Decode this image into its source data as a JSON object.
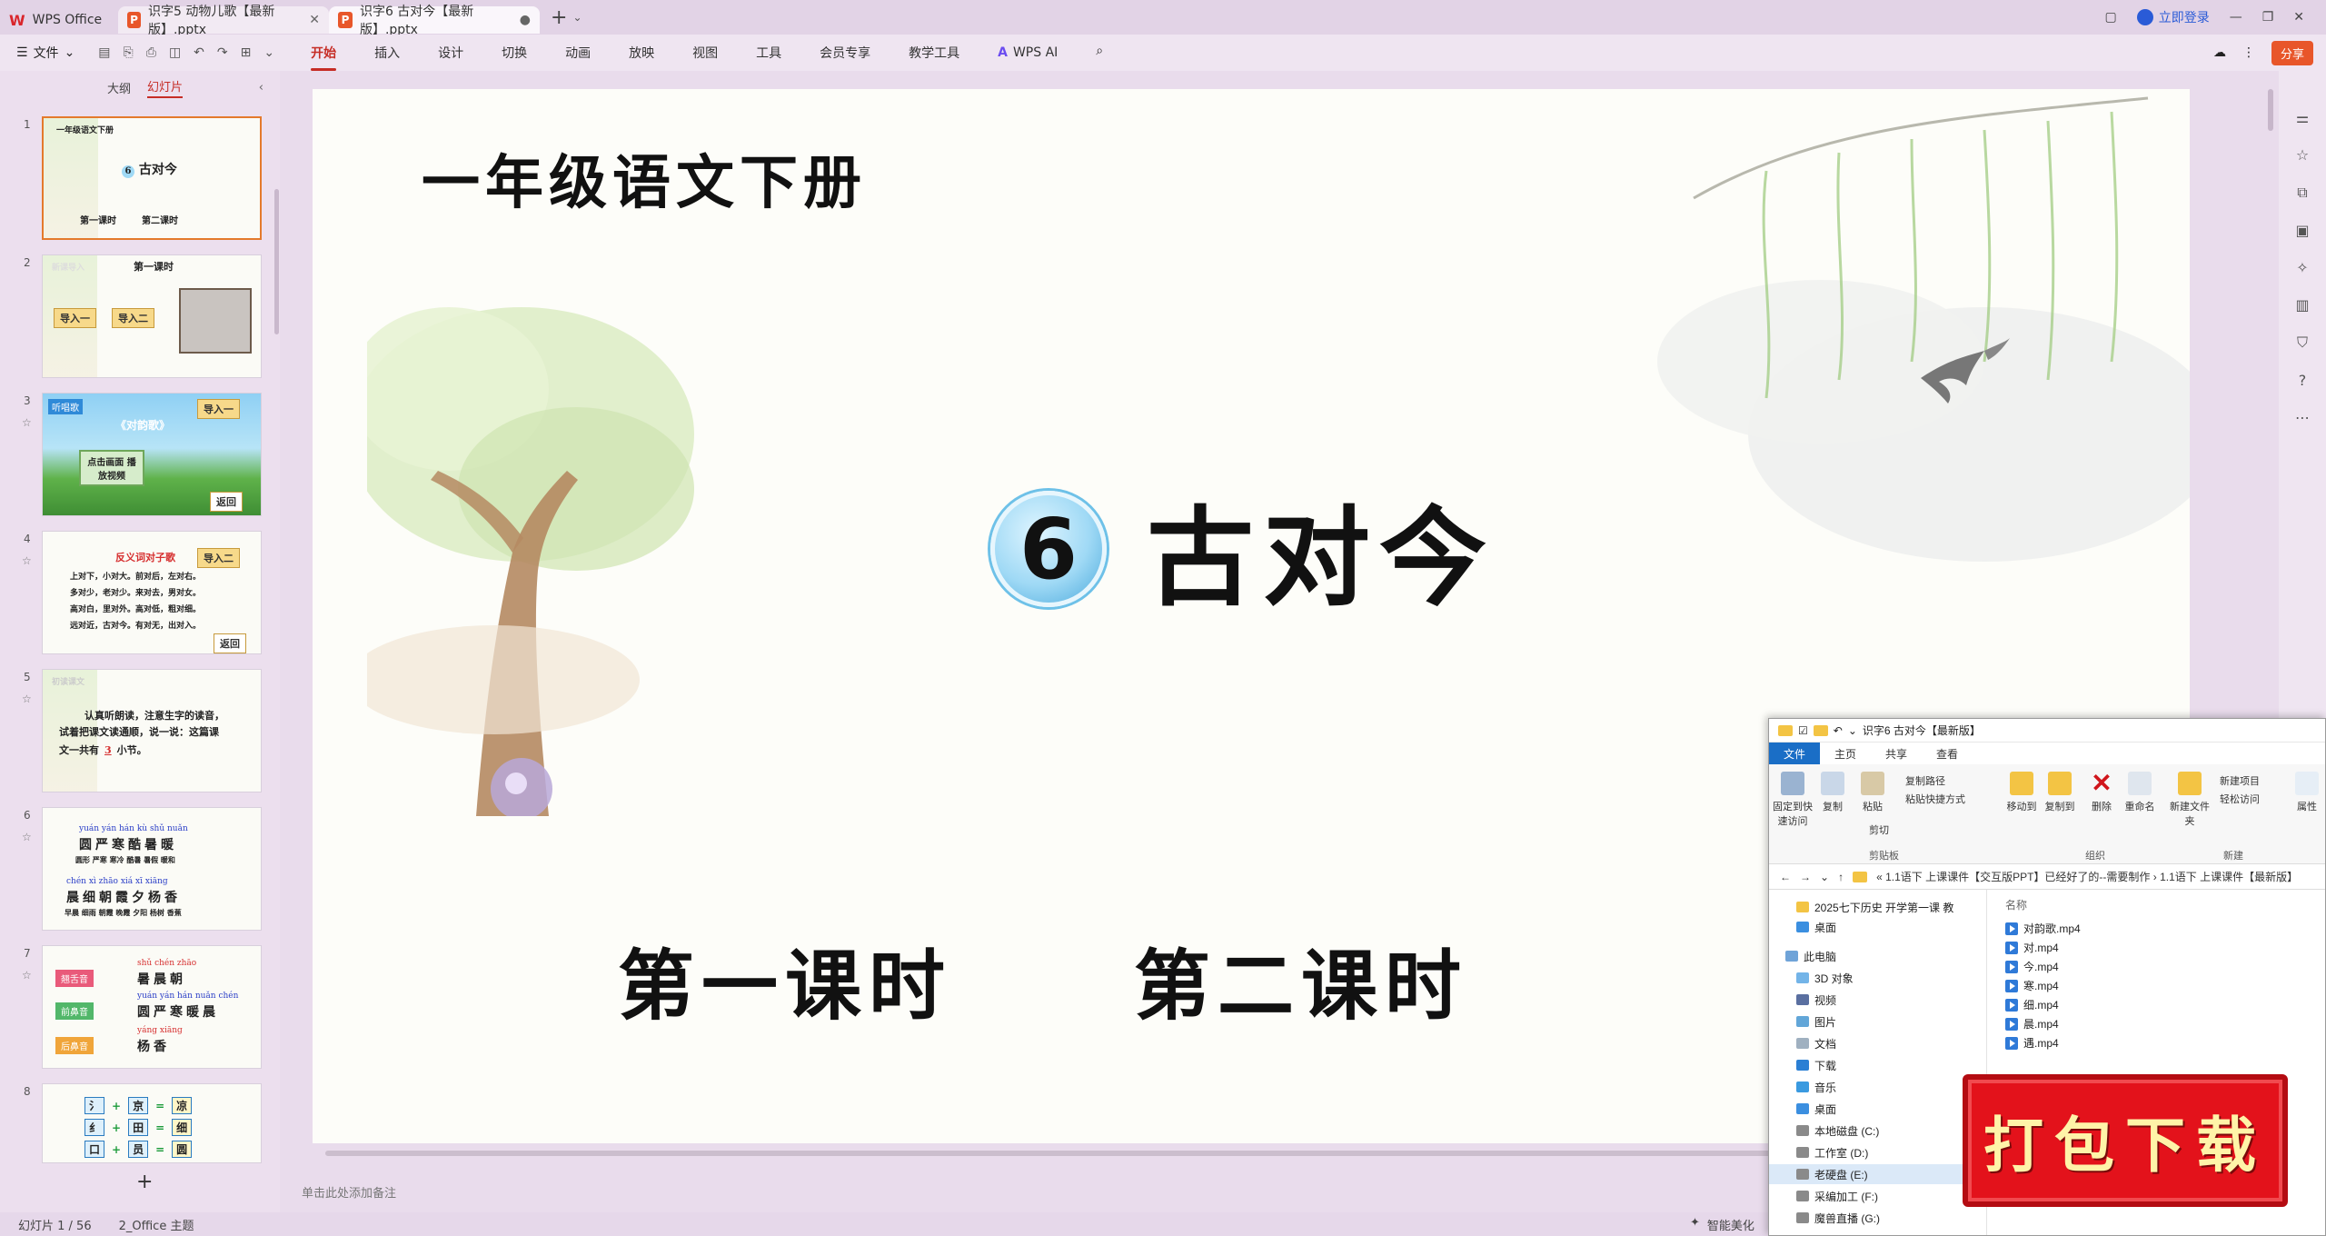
{
  "tabs": {
    "home": "WPS Office",
    "doc1": "识字5 动物儿歌【最新版】.pptx",
    "doc2": "识字6 古对今【最新版】.pptx"
  },
  "titlebar": {
    "login": "立即登录"
  },
  "menu": {
    "file": "文件",
    "items": [
      "开始",
      "插入",
      "设计",
      "切换",
      "动画",
      "放映",
      "视图",
      "工具",
      "会员专享",
      "教学工具"
    ],
    "wps_ai": "WPS AI",
    "share": "分享"
  },
  "panel": {
    "outline_tab": "大纲",
    "slides_tab": "幻灯片"
  },
  "thumbs": {
    "s1": {
      "num": "1",
      "top": "一年级语文下册",
      "title": "古对今",
      "p1": "第一课时",
      "p2": "第二课时"
    },
    "s2": {
      "num": "2",
      "heading": "第一课时",
      "corner": "新课导入",
      "b1": "导入一",
      "b2": "导入二"
    },
    "s3": {
      "num": "3",
      "badge": "听唱歌",
      "btn": "导入一",
      "song": "《对韵歌》",
      "box": "点击画面 播放视频",
      "back": "返回"
    },
    "s4": {
      "num": "4",
      "title": "反义词对子歌",
      "btn": "导入二",
      "lines": [
        "上对下，小对大。前对后，左对右。",
        "多对少，老对少。来对去，男对女。",
        "高对白，里对外。高对低，粗对细。",
        "远对近，古对今。有对无，出对入。"
      ],
      "back": "返回"
    },
    "s5": {
      "num": "5",
      "corner": "初读课文",
      "text1": "认真听朗读，注意生字的读音，",
      "text2": "试着把课文读通顺，说一说：这篇课",
      "text3": "文一共有",
      "blank": "3",
      "text4": "小节。"
    },
    "s6": {
      "num": "6",
      "row1_py": "yuán  yán  hán  kù  shǔ  nuǎn",
      "row1_hz": "圆严寒酷暑暖",
      "row1_words": "圆形 严寒 寒冷 酷暑 暑假 暖和",
      "row2_py": "chén  xì  zhāo  xiá  xī  xiāng",
      "row2_hz": "晨细朝霞夕杨香",
      "row2_words": "早晨 细雨 朝霞 晚霞 夕阳 杨树 香蕉"
    },
    "s7": {
      "num": "7",
      "tag1": "翘舌音",
      "tag2": "前鼻音",
      "tag3": "后鼻音",
      "py1": "shǔ  chén  zhāo",
      "hz1": "暑晨朝",
      "py2": "yuán  yán  hán  nuǎn  chén",
      "hz2": "圆严寒暖晨",
      "py3": "yáng  xiāng",
      "hz3": "杨香"
    },
    "s8": {
      "num": "8",
      "r1": [
        "氵",
        "+",
        "京",
        "=",
        "凉"
      ],
      "r2": [
        "纟",
        "+",
        "田",
        "=",
        "细"
      ],
      "r3": [
        "口",
        "+",
        "员",
        "=",
        "圆"
      ]
    }
  },
  "slide": {
    "top_title": "一年级语文下册",
    "lesson_number": "6",
    "lesson_title": "古对今",
    "period1": "第一课时",
    "period2": "第二课时"
  },
  "notes_placeholder": "单击此处添加备注",
  "status": {
    "slide_count": "幻灯片 1 / 56",
    "theme": "2_Office 主题",
    "beautify": "智能美化"
  },
  "explorer": {
    "title": "识字6 古对今【最新版】",
    "tabs": [
      "文件",
      "主页",
      "共享",
      "查看"
    ],
    "ribbon": {
      "pin": "固定到快速访问",
      "copy": "复制",
      "paste": "粘贴",
      "copy_path": "复制路径",
      "paste_shortcut": "粘贴快捷方式",
      "cut": "剪切",
      "move_to": "移动到",
      "copy_to": "复制到",
      "delete": "删除",
      "rename": "重命名",
      "new_folder": "新建文件夹",
      "new_item": "新建项目",
      "easy_access": "轻松访问",
      "props": "属性",
      "group_clip": "剪贴板",
      "group_org": "组织",
      "group_new": "新建"
    },
    "address": "« 1.1语下 上课课件【交互版PPT】已经好了的--需要制作 › 1.1语下 上课课件【最新版】",
    "nav": [
      "2025七下历史 开学第一课 教",
      "桌面",
      "此电脑",
      "3D 对象",
      "视频",
      "图片",
      "文档",
      "下载",
      "音乐",
      "桌面",
      "本地磁盘 (C:)",
      "工作室 (D:)",
      "老硬盘 (E:)",
      "采编加工 (F:)",
      "魔兽直播 (G:)"
    ],
    "files_header": "名称",
    "files": [
      "对韵歌.mp4",
      "对.mp4",
      "今.mp4",
      "寒.mp4",
      "细.mp4",
      "晨.mp4",
      "遇.mp4"
    ]
  },
  "stamp": "打包下载",
  "colors": {
    "accent": "#c62d26",
    "stamp": "#e3121b",
    "badge": "#6ec1e8"
  }
}
